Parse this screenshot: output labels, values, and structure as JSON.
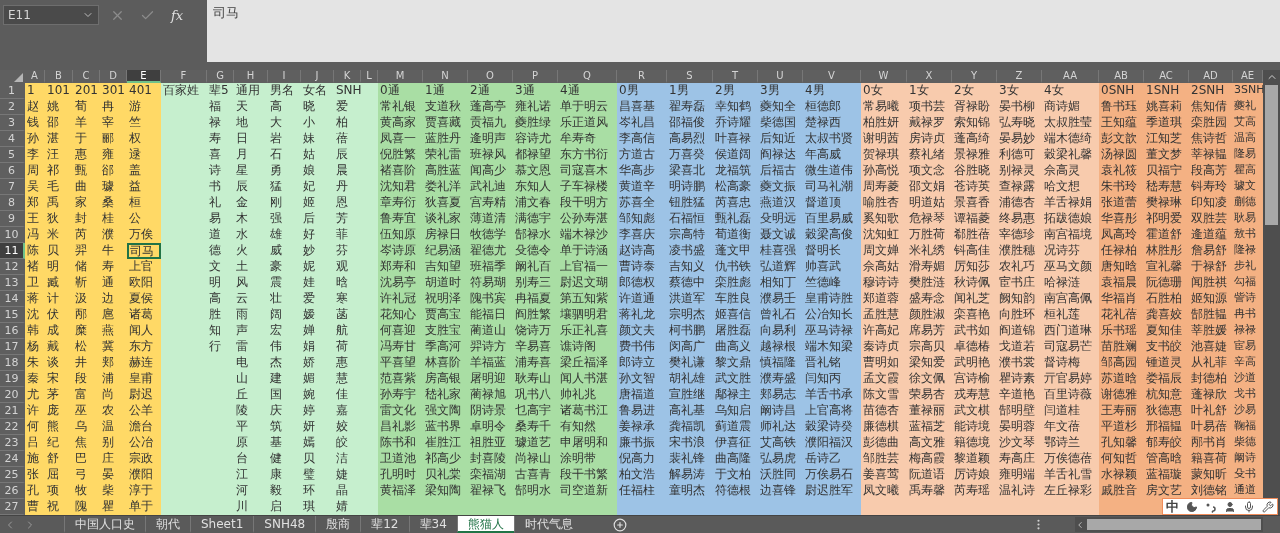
{
  "name_box": "E11",
  "formula_bar": {
    "function_label": "fx",
    "value": "司马"
  },
  "columns": [
    {
      "letter": "A",
      "selected": false,
      "color": "#ffd966",
      "cells": [
        "1",
        "赵",
        "钱",
        "孙",
        "李",
        "周",
        "吴",
        "郑",
        "王",
        "冯",
        "陈",
        "褚",
        "卫",
        "蒋",
        "沈",
        "韩",
        "杨",
        "朱",
        "秦",
        "尤",
        "许",
        "何",
        "吕",
        "施",
        "张",
        "孔",
        "曹"
      ]
    },
    {
      "letter": "B",
      "selected": false,
      "color": "#ffd966",
      "cells": [
        "101",
        "姚",
        "邵",
        "湛",
        "汪",
        "祁",
        "毛",
        "禹",
        "狄",
        "米",
        "贝",
        "明",
        "臧",
        "计",
        "伏",
        "成",
        "戴",
        "谈",
        "宋",
        "茅",
        "庞",
        "熊",
        "纪",
        "舒",
        "屈",
        "项",
        "祝"
      ]
    },
    {
      "letter": "C",
      "selected": false,
      "color": "#ffd966",
      "cells": [
        "201",
        "荀",
        "羊",
        "于",
        "惠",
        "甄",
        "曲",
        "家",
        "封",
        "芮",
        "羿",
        "储",
        "靳",
        "汲",
        "邴",
        "糜",
        "松",
        "井",
        "段",
        "富",
        "巫",
        "乌",
        "焦",
        "巴",
        "弓",
        "牧",
        "隗"
      ]
    },
    {
      "letter": "D",
      "selected": false,
      "color": "#ffd966",
      "cells": [
        "301",
        "冉",
        "宰",
        "郦",
        "雍",
        "郤",
        "璩",
        "桑",
        "桂",
        "濮",
        "牛",
        "寿",
        "通",
        "边",
        "扈",
        "燕",
        "冀",
        "郏",
        "浦",
        "尚",
        "农",
        "温",
        "别",
        "庄",
        "晏",
        "柴",
        "瞿"
      ]
    },
    {
      "letter": "E",
      "selected": true,
      "color": "#ffd966",
      "cells": [
        "401",
        "游",
        "竺",
        "权",
        "逯",
        "盖",
        "益",
        "桓",
        "公",
        "万俟",
        "司马",
        "上官",
        "欧阳",
        "夏侯",
        "诸葛",
        "闻人",
        "东方",
        "赫连",
        "皇甫",
        "尉迟",
        "公羊",
        "澹台",
        "公冶",
        "宗政",
        "濮阳",
        "淳于",
        "单于"
      ]
    },
    {
      "letter": "F",
      "selected": false,
      "color": "#c6efce",
      "cells": [
        "百家姓"
      ]
    },
    {
      "letter": "G",
      "selected": false,
      "color": "#c6efce",
      "cells": [
        "辈5",
        "福",
        "禄",
        "寿",
        "喜",
        "诗",
        "书",
        "礼",
        "易",
        "道",
        "德",
        "文",
        "明",
        "高",
        "胜",
        "知",
        "行"
      ]
    },
    {
      "letter": "H",
      "selected": false,
      "color": "#c6efce",
      "cells": [
        "通用",
        "天",
        "地",
        "日",
        "月",
        "星",
        "辰",
        "金",
        "木",
        "水",
        "火",
        "土",
        "风",
        "云",
        "雨",
        "声",
        "雷",
        "电",
        "山",
        "丘",
        "陵",
        "平",
        "原",
        "台",
        "江",
        "河",
        "川"
      ]
    },
    {
      "letter": "I",
      "selected": false,
      "color": "#c6efce",
      "cells": [
        "男名",
        "高",
        "大",
        "岩",
        "石",
        "勇",
        "猛",
        "刚",
        "强",
        "雄",
        "威",
        "豪",
        "震",
        "壮",
        "阔",
        "宏",
        "伟",
        "杰",
        "建",
        "国",
        "庆",
        "筑",
        "基",
        "健",
        "康",
        "毅",
        "启"
      ]
    },
    {
      "letter": "J",
      "selected": false,
      "color": "#c6efce",
      "cells": [
        "女名",
        "晓",
        "小",
        "妹",
        "姑",
        "娘",
        "妃",
        "姬",
        "后",
        "好",
        "妙",
        "妮",
        "娃",
        "爱",
        "嫒",
        "婵",
        "娟",
        "娇",
        "媚",
        "婉",
        "婷",
        "妍",
        "嫣",
        "贝",
        "璧",
        "环",
        "琪"
      ]
    },
    {
      "letter": "K",
      "selected": false,
      "color": "#c6efce",
      "cells": [
        "SNH",
        "爱",
        "柏",
        "蓓",
        "辰",
        "晨",
        "丹",
        "恩",
        "芳",
        "菲",
        "芬",
        "观",
        "晗",
        "寒",
        "菡",
        "航",
        "荷",
        "惠",
        "慧",
        "佳",
        "嘉",
        "姣",
        "皎",
        "洁",
        "婕",
        "晶",
        "婧"
      ]
    },
    {
      "letter": "L",
      "selected": false,
      "color": "#c6efce"
    },
    {
      "letter": "M",
      "selected": false,
      "color": "#a9dea4",
      "cells": [
        "0通",
        "常礼银",
        "黄高家",
        "凤喜一",
        "倪胜繁",
        "褚喜阶",
        "沈知君",
        "章寿衍",
        "鲁寿宜",
        "伍知原",
        "岑诗原",
        "郑寿和",
        "沈易亭",
        "许礼冠",
        "花知心",
        "何喜迎",
        "冯寿甘",
        "平喜望",
        "范喜紫",
        "孙寿宇",
        "雷文化",
        "昌礼影",
        "陈书和",
        "卫道池",
        "孔明时",
        "黄福泽"
      ]
    },
    {
      "letter": "N",
      "selected": false,
      "color": "#a9dea4",
      "cells": [
        "1通",
        "支道秋",
        "贾喜藏",
        "蓝胜丹",
        "荣礼雷",
        "高胜蓝",
        "娄礼洋",
        "狄喜夏",
        "谈礼家",
        "房禄日",
        "纪易涵",
        "吉知望",
        "胡道时",
        "祝明泽",
        "贾高宝",
        "支胜宝",
        "季高河",
        "林喜阶",
        "房高银",
        "嵇礼家",
        "强文陶",
        "蓝书界",
        "崔胜江",
        "祁高少",
        "贝礼棠",
        "梁知陶"
      ]
    },
    {
      "letter": "O",
      "selected": false,
      "color": "#a9dea4",
      "cells": [
        "2通",
        "蓬高亭",
        "贡福九",
        "逄明声",
        "班禄风",
        "闻高少",
        "武礼迪",
        "宫寿精",
        "薄道清",
        "牧德学",
        "翟德尤",
        "班福季",
        "符易瑚",
        "隗书宾",
        "能福日",
        "蔺道山",
        "羿诗方",
        "羊福蓝",
        "屠明迎",
        "蔺禄旭",
        "阴诗景",
        "卓明令",
        "祖胜亚",
        "封喜陵",
        "栾福湖",
        "翟禄飞"
      ]
    },
    {
      "letter": "P",
      "selected": false,
      "color": "#a9dea4",
      "cells": [
        "3通",
        "雍礼诺",
        "夔胜绿",
        "容诗尤",
        "都禄望",
        "慕文恩",
        "东知人",
        "浦文春",
        "满德宇",
        "郜禄水",
        "殳德令",
        "阚礼百",
        "别寿三",
        "冉福夏",
        "阎胜繁",
        "饶诗万",
        "辛易喜",
        "浦寿喜",
        "耿寿山",
        "巩书八",
        "乜高宇",
        "桑寿千",
        "璩道艺",
        "尚禄山",
        "古喜青",
        "郜明水"
      ]
    },
    {
      "letter": "Q",
      "selected": false,
      "color": "#a9dea4",
      "cells": [
        "4通",
        "单于明云",
        "乐正道风",
        "牟寿奇",
        "东方书衍",
        "司寇喜木",
        "子车禄楼",
        "段干明方",
        "公孙寿湛",
        "端木禄沙",
        "单于诗涵",
        "上官福一",
        "尉迟文瑚",
        "第五知紫",
        "壤驷明君",
        "乐正礼喜",
        "谯诗阁",
        "梁丘福泽",
        "闻人书湛",
        "帅礼兆",
        "诸葛书江",
        "有知然",
        "申屠明和",
        "涂明带",
        "段干书繁",
        "司空道新"
      ]
    },
    {
      "letter": "R",
      "selected": false,
      "color": "#9dc3e6",
      "cells": [
        "0男",
        "昌喜基",
        "岑礼昌",
        "李高信",
        "方道古",
        "华高步",
        "黄道辛",
        "苏喜全",
        "邹知彪",
        "李喜庆",
        "赵诗高",
        "曹诗泰",
        "郎德权",
        "许道通",
        "蒋礼龙",
        "颜文夫",
        "费书伟",
        "郎诗立",
        "孙文智",
        "唐福道",
        "鲁易进",
        "姜禄承",
        "廉书振",
        "倪高力",
        "柏文浩",
        "任福柱"
      ]
    },
    {
      "letter": "S",
      "selected": false,
      "color": "#9dc3e6",
      "cells": [
        "1男",
        "翟寿磊",
        "邵福俊",
        "高易烈",
        "万喜癸",
        "梁喜北",
        "明诗鹏",
        "钮胜猛",
        "石福恒",
        "宗高特",
        "凌书盛",
        "吉知义",
        "蔡德中",
        "洪道军",
        "宗明杰",
        "柯书鹏",
        "闵高广",
        "樊礼谦",
        "胡礼雄",
        "宣胜继",
        "高礼基",
        "龚福凯",
        "宋书浪",
        "裴礼锋",
        "解易涛",
        "童明杰"
      ]
    },
    {
      "letter": "T",
      "selected": false,
      "color": "#9dc3e6",
      "cells": [
        "2男",
        "幸知鹤",
        "乔诗耀",
        "叶喜禄",
        "侯道阔",
        "龙福筑",
        "松高豪",
        "芮喜忠",
        "甄礼磊",
        "荀道衡",
        "蓬文甲",
        "仇书铁",
        "栾胜彪",
        "车胜良",
        "姬喜信",
        "屠胜磊",
        "曲高义",
        "黎文鼎",
        "武文胜",
        "鄅禄主",
        "乌知启",
        "蓟道震",
        "伊喜征",
        "曲高隆",
        "于文柏",
        "符德根"
      ]
    },
    {
      "letter": "U",
      "selected": false,
      "color": "#9dc3e6",
      "cells": [
        "3男",
        "夔知全",
        "柴德国",
        "后知近",
        "阎禄达",
        "后福古",
        "夔文振",
        "燕道汉",
        "殳明远",
        "聂文诚",
        "桂喜强",
        "弘道辉",
        "相知丁",
        "濮易壬",
        "曾礼石",
        "向易利",
        "越禄根",
        "慎福隆",
        "濮寿盛",
        "郏易志",
        "阚诗昌",
        "师礼达",
        "艾高铁",
        "弘易虎",
        "沃胜同",
        "边喜锋"
      ]
    },
    {
      "letter": "V",
      "selected": false,
      "color": "#9dc3e6",
      "cells": [
        "4男",
        "桓德郎",
        "楚禄西",
        "太叔书贤",
        "年高威",
        "微生道伟",
        "司马礼潮",
        "督道顶",
        "百里易威",
        "穀梁高俊",
        "督明长",
        "帅喜武",
        "竺德峰",
        "皇甫诗胜",
        "公冶知长",
        "巫马诗禄",
        "端木知梁",
        "晋礼铭",
        "闫知丙",
        "羊舌书承",
        "上官高将",
        "穀梁诗癸",
        "濮阳福汉",
        "岳诗乙",
        "万俟易石",
        "尉迟胜军"
      ]
    },
    {
      "letter": "W",
      "selected": false,
      "color": "#f8cbad",
      "cells": [
        "0女",
        "常易曦",
        "柏胜妍",
        "谢明茜",
        "贺禄琪",
        "孙高悦",
        "周寿菱",
        "喻胜杏",
        "奚知歌",
        "沈知虹",
        "周文婵",
        "佘高姑",
        "穆诗诗",
        "郑道蓉",
        "孟胜慧",
        "许高妃",
        "秦诗贞",
        "曹明如",
        "孟文霞",
        "陈文雪",
        "苗德杏",
        "廉德棋",
        "彭德曲",
        "邹胜芸",
        "姜喜莺",
        "凤文曦"
      ]
    },
    {
      "letter": "X",
      "selected": false,
      "color": "#f8cbad",
      "cells": [
        "1女",
        "项书芸",
        "戴禄罗",
        "房诗贞",
        "蔡礼绪",
        "项文念",
        "邵文娟",
        "明道姑",
        "危禄琴",
        "万胜荷",
        "米礼绣",
        "滑寿媚",
        "樊胜涟",
        "盛寿念",
        "颜胜淑",
        "席易芳",
        "宗高贝",
        "梁知爱",
        "徐文佩",
        "荣易杏",
        "董禄丽",
        "蓝福芝",
        "高文雅",
        "梅高霞",
        "阮道语",
        "禹寿馨"
      ]
    },
    {
      "letter": "Y",
      "selected": false,
      "color": "#f8cbad",
      "cells": [
        "2女",
        "胥禄盼",
        "索知锦",
        "蓬高绮",
        "景禄雅",
        "谷胜晓",
        "苍诗英",
        "景喜香",
        "谭福菱",
        "郗胜蓓",
        "钭高佳",
        "厉知莎",
        "秋诗佩",
        "闻礼芝",
        "栾喜艳",
        "武书如",
        "卓德椿",
        "武明艳",
        "宫诗榆",
        "戎寿慧",
        "武文棋",
        "能诗境",
        "籍德境",
        "黎道颖",
        "厉诗娘",
        "芮寿瑶"
      ]
    },
    {
      "letter": "Z",
      "selected": false,
      "color": "#f8cbad",
      "cells": [
        "3女",
        "晏书柳",
        "弘寿晓",
        "晏易妙",
        "利德可",
        "别禄灵",
        "查禄露",
        "浦德杏",
        "终易惠",
        "宰德珍",
        "濮胜穗",
        "农礼巧",
        "宦书庄",
        "阙知韵",
        "向胜环",
        "阎道锦",
        "戈道若",
        "濮书裳",
        "瞿诗素",
        "辛道艳",
        "郜明壁",
        "晏明蓉",
        "沙文琴",
        "寿高庄",
        "雍明端",
        "温礼诗"
      ]
    },
    {
      "letter": "AA",
      "selected": false,
      "color": "#f8cbad",
      "cells": [
        "4女",
        "商诗媚",
        "太叔胜莹",
        "端木德绮",
        "穀梁礼馨",
        "佘高灵",
        "哈文想",
        "羊舌禄娟",
        "拓跋德娘",
        "南宫福境",
        "况诗芬",
        "巫马文颜",
        "哈禄涟",
        "南宫高佩",
        "桓礼莲",
        "西门道琳",
        "司寇易芒",
        "督诗梅",
        "亓官易婷",
        "百里诗薇",
        "闫道桂",
        "年文蓓",
        "鄂诗兰",
        "万俟德蓓",
        "羊舌礼雪",
        "左丘禄彩"
      ]
    },
    {
      "letter": "AB",
      "selected": false,
      "color": "#f4b183",
      "cells": [
        "0SNH",
        "鲁书珏",
        "王知蕴",
        "彭文歆",
        "汤禄圆",
        "袁礼筱",
        "朱书玲",
        "张道蕾",
        "华喜彤",
        "凤高玲",
        "任禄柏",
        "唐知晗",
        "袁福晨",
        "华福肖",
        "花礼蓓",
        "乐书瑶",
        "苗胜斓",
        "邹高园",
        "苏道晗",
        "谢德雅",
        "王寿丽",
        "平道杉",
        "孔知馨",
        "何知哲",
        "水禄颖",
        "戚胜音"
      ]
    },
    {
      "letter": "AC",
      "selected": false,
      "color": "#f4b183",
      "cells": [
        "1SNH",
        "姚喜莉",
        "季道琪",
        "江知芝",
        "董文梦",
        "贝福宁",
        "嵇寿慧",
        "樊禄琳",
        "祁明爱",
        "霍道舒",
        "林胜彤",
        "宣礼馨",
        "阮德珊",
        "石胜柏",
        "龚喜姣",
        "夏知佳",
        "支书皎",
        "锺道灵",
        "娄福辰",
        "杭知意",
        "狄德惠",
        "邢福韫",
        "郁寿皎",
        "管高晗",
        "蓝福璇",
        "房文艺"
      ]
    },
    {
      "letter": "AD",
      "selected": false,
      "color": "#f4b183",
      "cells": [
        "2SNH",
        "焦知倩",
        "栾胜园",
        "焦诗哲",
        "莘禄韫",
        "段高芳",
        "钭寿玲",
        "印知凌",
        "双胜芸",
        "逄道蕴",
        "詹易舒",
        "于禄舒",
        "闻胜祺",
        "姬知源",
        "郜胜韫",
        "莘胜媛",
        "池喜婕",
        "从礼菲",
        "封德柏",
        "蓬禄欣",
        "叶礼舒",
        "叶易蓓",
        "邴书肖",
        "籍喜荷",
        "蒙知昕",
        "刘德铭"
      ]
    },
    {
      "letter": "AE",
      "selected": false,
      "color": "#f4b183",
      "cells": [
        "3SNH",
        "夔礼",
        "艾高",
        "温高",
        "隆易",
        "瞿高",
        "璩文",
        "蒯德",
        "耿易",
        "敖书",
        "隆禄",
        "步礼",
        "勾福",
        "訾诗",
        "冉书",
        "禄禄",
        "宦易",
        "辛高",
        "沙道",
        "戈书",
        "沙易",
        "鞠福",
        "柴德",
        "阚诗",
        "殳书",
        "通道"
      ]
    }
  ],
  "rows": [
    {
      "number": "1",
      "selected": false
    },
    {
      "number": "2",
      "selected": false
    },
    {
      "number": "3",
      "selected": false
    },
    {
      "number": "4",
      "selected": false
    },
    {
      "number": "5",
      "selected": false
    },
    {
      "number": "6",
      "selected": false
    },
    {
      "number": "7",
      "selected": false
    },
    {
      "number": "8",
      "selected": false
    },
    {
      "number": "9",
      "selected": false
    },
    {
      "number": "10",
      "selected": false
    },
    {
      "number": "11",
      "selected": true
    },
    {
      "number": "12",
      "selected": false
    },
    {
      "number": "13",
      "selected": false
    },
    {
      "number": "14",
      "selected": false
    },
    {
      "number": "15",
      "selected": false
    },
    {
      "number": "16",
      "selected": false
    },
    {
      "number": "17",
      "selected": false
    },
    {
      "number": "18",
      "selected": false
    },
    {
      "number": "19",
      "selected": false
    },
    {
      "number": "20",
      "selected": false
    },
    {
      "number": "21",
      "selected": false
    },
    {
      "number": "22",
      "selected": false
    },
    {
      "number": "23",
      "selected": false
    },
    {
      "number": "24",
      "selected": false
    },
    {
      "number": "25",
      "selected": false
    },
    {
      "number": "26",
      "selected": false
    },
    {
      "number": "27",
      "selected": false
    }
  ],
  "sheet_tabs": [
    {
      "label": "中国人口史",
      "selected": false
    },
    {
      "label": "朝代",
      "selected": false
    },
    {
      "label": "Sheet1",
      "selected": false
    },
    {
      "label": "SNH48",
      "selected": false
    },
    {
      "label": "殷商",
      "selected": false
    },
    {
      "label": "辈12",
      "selected": false
    },
    {
      "label": "辈34",
      "selected": false
    },
    {
      "label": "熊猫人",
      "selected": true
    },
    {
      "label": "时代气息",
      "selected": false
    }
  ],
  "ime_toolbar": {
    "mode": "中"
  }
}
